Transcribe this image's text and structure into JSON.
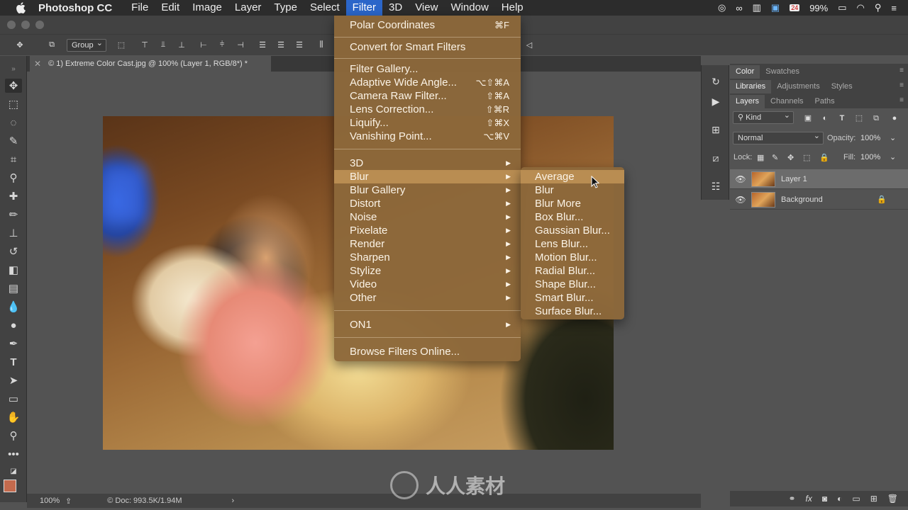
{
  "menubar": {
    "app_name": "Photoshop CC",
    "items": [
      "File",
      "Edit",
      "Image",
      "Layer",
      "Type",
      "Select",
      "Filter",
      "3D",
      "View",
      "Window",
      "Help"
    ],
    "active_item": "Filter",
    "calendar_day": "24",
    "battery": "99%"
  },
  "options_bar": {
    "auto_select": "Group"
  },
  "document": {
    "tab_title": "© 1) Extreme Color Cast.jpg @ 100% (Layer 1, RGB/8*) *"
  },
  "status_bar": {
    "zoom": "100%",
    "doc_size": "© Doc: 993.5K/1.94M"
  },
  "panels": {
    "top_tabs": [
      "Color",
      "Swatches"
    ],
    "mid_tabs": [
      "Libraries",
      "Adjustments",
      "Styles"
    ],
    "layer_tabs": [
      "Layers",
      "Channels",
      "Paths"
    ],
    "filter_kind": "Kind",
    "blend_mode": "Normal",
    "opacity_label": "Opacity:",
    "opacity_value": "100%",
    "lock_label": "Lock:",
    "fill_label": "Fill:",
    "fill_value": "100%",
    "layers": [
      {
        "name": "Layer 1",
        "selected": true
      },
      {
        "name": "Background",
        "selected": false,
        "locked": true
      }
    ]
  },
  "filter_menu": {
    "last_filter": {
      "label": "Polar Coordinates",
      "shortcut": "⌘F"
    },
    "smart": "Convert for Smart Filters",
    "group2": [
      {
        "label": "Filter Gallery...",
        "shortcut": ""
      },
      {
        "label": "Adaptive Wide Angle...",
        "shortcut": "⌥⇧⌘A"
      },
      {
        "label": "Camera Raw Filter...",
        "shortcut": "⇧⌘A"
      },
      {
        "label": "Lens Correction...",
        "shortcut": "⇧⌘R"
      },
      {
        "label": "Liquify...",
        "shortcut": "⇧⌘X"
      },
      {
        "label": "Vanishing Point...",
        "shortcut": "⌥⌘V"
      }
    ],
    "submenus": [
      "3D",
      "Blur",
      "Blur Gallery",
      "Distort",
      "Noise",
      "Pixelate",
      "Render",
      "Sharpen",
      "Stylize",
      "Video",
      "Other"
    ],
    "highlighted": "Blur",
    "plugin": "ON1",
    "browse": "Browse Filters Online..."
  },
  "blur_menu": {
    "items": [
      "Average",
      "Blur",
      "Blur More",
      "Box Blur...",
      "Gaussian Blur...",
      "Lens Blur...",
      "Motion Blur...",
      "Radial Blur...",
      "Shape Blur...",
      "Smart Blur...",
      "Surface Blur..."
    ],
    "highlighted": "Average"
  },
  "watermark": "人人素材"
}
